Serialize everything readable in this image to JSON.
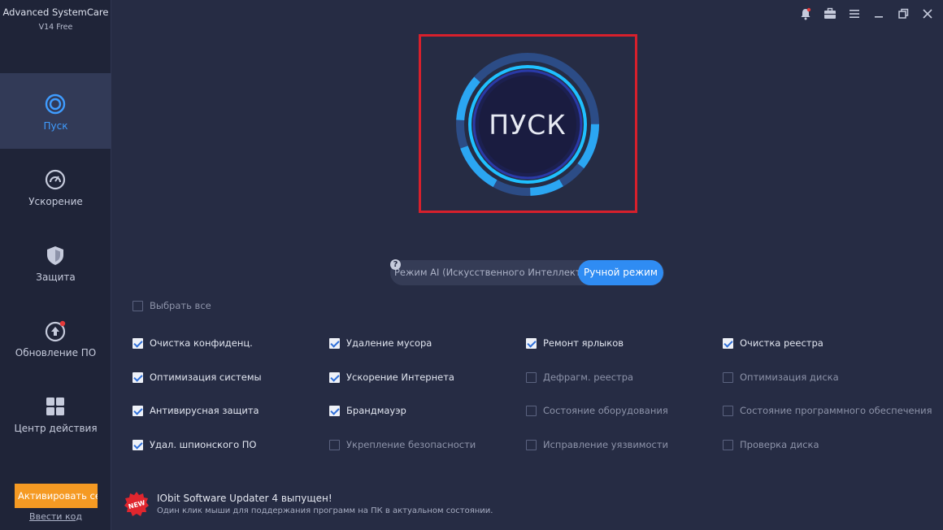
{
  "app": {
    "name": "Advanced SystemCare",
    "version": "V14 Free"
  },
  "sidebar": {
    "items": [
      {
        "label": "Пуск",
        "icon": "target-icon",
        "active": true
      },
      {
        "label": "Ускорение",
        "icon": "speedometer-icon",
        "active": false
      },
      {
        "label": "Защита",
        "icon": "shield-icon",
        "active": false
      },
      {
        "label": "Обновление ПО",
        "icon": "update-arrow-icon",
        "active": false
      },
      {
        "label": "Центр действия",
        "icon": "grid-icon",
        "active": false
      }
    ],
    "activate_label": "Активировать се...",
    "enter_code_label": "Ввести код"
  },
  "window_controls": [
    "bell-icon",
    "briefcase-icon",
    "menu-icon",
    "minimize-icon",
    "restore-icon",
    "close-icon"
  ],
  "scan": {
    "label": "ПУСК"
  },
  "mode": {
    "ai_label": "Режим AI (Искусственного  Интеллекта)",
    "manual_label": "Ручной режим",
    "help": "?"
  },
  "select_all": {
    "label": "Выбрать все",
    "checked": false
  },
  "checks": [
    {
      "label": "Очистка конфиденц.",
      "checked": true
    },
    {
      "label": "Удаление мусора",
      "checked": true
    },
    {
      "label": "Ремонт ярлыков",
      "checked": true
    },
    {
      "label": "Очистка реестра",
      "checked": true
    },
    {
      "label": "Оптимизация системы",
      "checked": true
    },
    {
      "label": "Ускорение Интернета",
      "checked": true
    },
    {
      "label": "Дефрагм. реестра",
      "checked": false
    },
    {
      "label": "Оптимизация диска",
      "checked": false
    },
    {
      "label": "Антивирусная защита",
      "checked": true
    },
    {
      "label": "Брандмауэр",
      "checked": true
    },
    {
      "label": "Состояние оборудования",
      "checked": false
    },
    {
      "label": "Состояние программного обеспечения",
      "checked": false
    },
    {
      "label": "Удал. шпионского ПО",
      "checked": true
    },
    {
      "label": "Укрепление безопасности",
      "checked": false
    },
    {
      "label": "Исправление уязвимости",
      "checked": false
    },
    {
      "label": "Проверка диска",
      "checked": false
    }
  ],
  "news": {
    "badge": "NEW",
    "title": "IObit Software Updater 4 выпущен!",
    "description": "Один клик мыши для поддержания программ на ПК в актуальном состоянии."
  },
  "colors": {
    "background": "#262c44",
    "sidebar": "#1f2438",
    "accent": "#2f8cf3",
    "ring": "#1fb6f5",
    "activate": "#f59a23",
    "highlight": "#d7202c"
  }
}
